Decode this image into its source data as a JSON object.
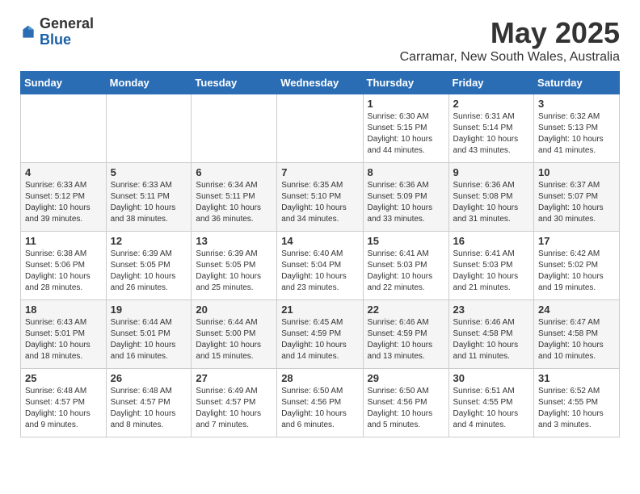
{
  "header": {
    "logo_general": "General",
    "logo_blue": "Blue",
    "title": "May 2025",
    "subtitle": "Carramar, New South Wales, Australia"
  },
  "weekdays": [
    "Sunday",
    "Monday",
    "Tuesday",
    "Wednesday",
    "Thursday",
    "Friday",
    "Saturday"
  ],
  "weeks": [
    [
      {
        "day": "",
        "info": ""
      },
      {
        "day": "",
        "info": ""
      },
      {
        "day": "",
        "info": ""
      },
      {
        "day": "",
        "info": ""
      },
      {
        "day": "1",
        "info": "Sunrise: 6:30 AM\nSunset: 5:15 PM\nDaylight: 10 hours\nand 44 minutes."
      },
      {
        "day": "2",
        "info": "Sunrise: 6:31 AM\nSunset: 5:14 PM\nDaylight: 10 hours\nand 43 minutes."
      },
      {
        "day": "3",
        "info": "Sunrise: 6:32 AM\nSunset: 5:13 PM\nDaylight: 10 hours\nand 41 minutes."
      }
    ],
    [
      {
        "day": "4",
        "info": "Sunrise: 6:33 AM\nSunset: 5:12 PM\nDaylight: 10 hours\nand 39 minutes."
      },
      {
        "day": "5",
        "info": "Sunrise: 6:33 AM\nSunset: 5:11 PM\nDaylight: 10 hours\nand 38 minutes."
      },
      {
        "day": "6",
        "info": "Sunrise: 6:34 AM\nSunset: 5:11 PM\nDaylight: 10 hours\nand 36 minutes."
      },
      {
        "day": "7",
        "info": "Sunrise: 6:35 AM\nSunset: 5:10 PM\nDaylight: 10 hours\nand 34 minutes."
      },
      {
        "day": "8",
        "info": "Sunrise: 6:36 AM\nSunset: 5:09 PM\nDaylight: 10 hours\nand 33 minutes."
      },
      {
        "day": "9",
        "info": "Sunrise: 6:36 AM\nSunset: 5:08 PM\nDaylight: 10 hours\nand 31 minutes."
      },
      {
        "day": "10",
        "info": "Sunrise: 6:37 AM\nSunset: 5:07 PM\nDaylight: 10 hours\nand 30 minutes."
      }
    ],
    [
      {
        "day": "11",
        "info": "Sunrise: 6:38 AM\nSunset: 5:06 PM\nDaylight: 10 hours\nand 28 minutes."
      },
      {
        "day": "12",
        "info": "Sunrise: 6:39 AM\nSunset: 5:05 PM\nDaylight: 10 hours\nand 26 minutes."
      },
      {
        "day": "13",
        "info": "Sunrise: 6:39 AM\nSunset: 5:05 PM\nDaylight: 10 hours\nand 25 minutes."
      },
      {
        "day": "14",
        "info": "Sunrise: 6:40 AM\nSunset: 5:04 PM\nDaylight: 10 hours\nand 23 minutes."
      },
      {
        "day": "15",
        "info": "Sunrise: 6:41 AM\nSunset: 5:03 PM\nDaylight: 10 hours\nand 22 minutes."
      },
      {
        "day": "16",
        "info": "Sunrise: 6:41 AM\nSunset: 5:03 PM\nDaylight: 10 hours\nand 21 minutes."
      },
      {
        "day": "17",
        "info": "Sunrise: 6:42 AM\nSunset: 5:02 PM\nDaylight: 10 hours\nand 19 minutes."
      }
    ],
    [
      {
        "day": "18",
        "info": "Sunrise: 6:43 AM\nSunset: 5:01 PM\nDaylight: 10 hours\nand 18 minutes."
      },
      {
        "day": "19",
        "info": "Sunrise: 6:44 AM\nSunset: 5:01 PM\nDaylight: 10 hours\nand 16 minutes."
      },
      {
        "day": "20",
        "info": "Sunrise: 6:44 AM\nSunset: 5:00 PM\nDaylight: 10 hours\nand 15 minutes."
      },
      {
        "day": "21",
        "info": "Sunrise: 6:45 AM\nSunset: 4:59 PM\nDaylight: 10 hours\nand 14 minutes."
      },
      {
        "day": "22",
        "info": "Sunrise: 6:46 AM\nSunset: 4:59 PM\nDaylight: 10 hours\nand 13 minutes."
      },
      {
        "day": "23",
        "info": "Sunrise: 6:46 AM\nSunset: 4:58 PM\nDaylight: 10 hours\nand 11 minutes."
      },
      {
        "day": "24",
        "info": "Sunrise: 6:47 AM\nSunset: 4:58 PM\nDaylight: 10 hours\nand 10 minutes."
      }
    ],
    [
      {
        "day": "25",
        "info": "Sunrise: 6:48 AM\nSunset: 4:57 PM\nDaylight: 10 hours\nand 9 minutes."
      },
      {
        "day": "26",
        "info": "Sunrise: 6:48 AM\nSunset: 4:57 PM\nDaylight: 10 hours\nand 8 minutes."
      },
      {
        "day": "27",
        "info": "Sunrise: 6:49 AM\nSunset: 4:57 PM\nDaylight: 10 hours\nand 7 minutes."
      },
      {
        "day": "28",
        "info": "Sunrise: 6:50 AM\nSunset: 4:56 PM\nDaylight: 10 hours\nand 6 minutes."
      },
      {
        "day": "29",
        "info": "Sunrise: 6:50 AM\nSunset: 4:56 PM\nDaylight: 10 hours\nand 5 minutes."
      },
      {
        "day": "30",
        "info": "Sunrise: 6:51 AM\nSunset: 4:55 PM\nDaylight: 10 hours\nand 4 minutes."
      },
      {
        "day": "31",
        "info": "Sunrise: 6:52 AM\nSunset: 4:55 PM\nDaylight: 10 hours\nand 3 minutes."
      }
    ]
  ]
}
